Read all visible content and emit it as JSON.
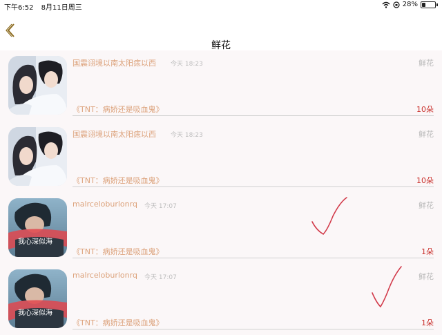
{
  "status_bar": {
    "time": "下午6:52",
    "date": "8月11日周三",
    "battery": "28%",
    "battery_level": 0.28
  },
  "nav": {
    "title": "鲜花"
  },
  "items": [
    {
      "username": "国震诩境以南太阳痣以西",
      "time": "今天 18:23",
      "gift": "鲜花",
      "book": "《TNT：病娇还是吸血鬼》",
      "count": "10朵",
      "avatar": "couple-avatar"
    },
    {
      "username": "国震诩境以南太阳痣以西",
      "time": "今天 18:23",
      "gift": "鲜花",
      "book": "《TNT：病娇还是吸血鬼》",
      "count": "10朵",
      "avatar": "couple-avatar"
    },
    {
      "username": "malrceloburlonrq",
      "time": "今天 17:07",
      "gift": "鲜花",
      "book": "《TNT：病娇还是吸血鬼》",
      "count": "1朵",
      "avatar": "portrait-avatar",
      "avatar_caption": "我心深似海"
    },
    {
      "username": "malrceloburlonrq",
      "time": "今天 17:07",
      "gift": "鲜花",
      "book": "《TNT：病娇还是吸血鬼》",
      "count": "1朵",
      "avatar": "portrait-avatar",
      "avatar_caption": "我心深似海"
    }
  ],
  "colors": {
    "accent": "#dca27b",
    "count": "#c9302c",
    "check": "#d23a4a"
  }
}
